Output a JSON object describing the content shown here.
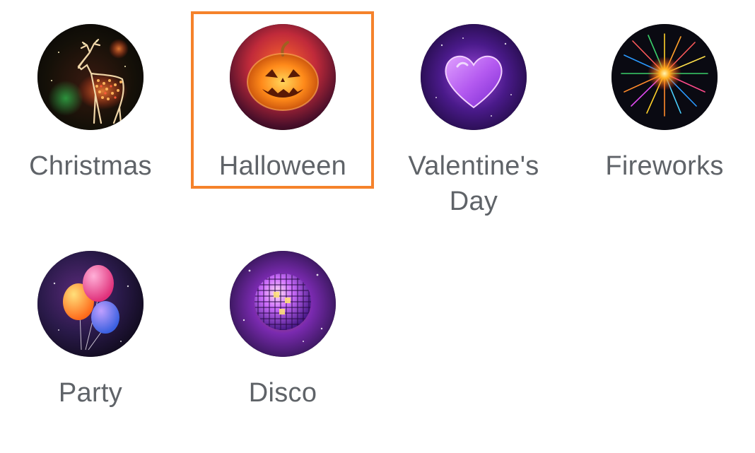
{
  "effects": [
    {
      "id": "christmas",
      "label": "Christmas",
      "icon": "reindeer-lights-icon"
    },
    {
      "id": "halloween",
      "label": "Halloween",
      "icon": "jack-o-lantern-icon",
      "selected": true
    },
    {
      "id": "valentines",
      "label": "Valentine's Day",
      "icon": "glowing-heart-icon"
    },
    {
      "id": "fireworks",
      "label": "Fireworks",
      "icon": "firework-burst-icon"
    },
    {
      "id": "party",
      "label": "Party",
      "icon": "balloons-icon"
    },
    {
      "id": "disco",
      "label": "Disco",
      "icon": "disco-ball-icon"
    }
  ],
  "colors": {
    "selection_border": "#f5822b",
    "label_text": "#5f6368",
    "background": "#ffffff"
  }
}
